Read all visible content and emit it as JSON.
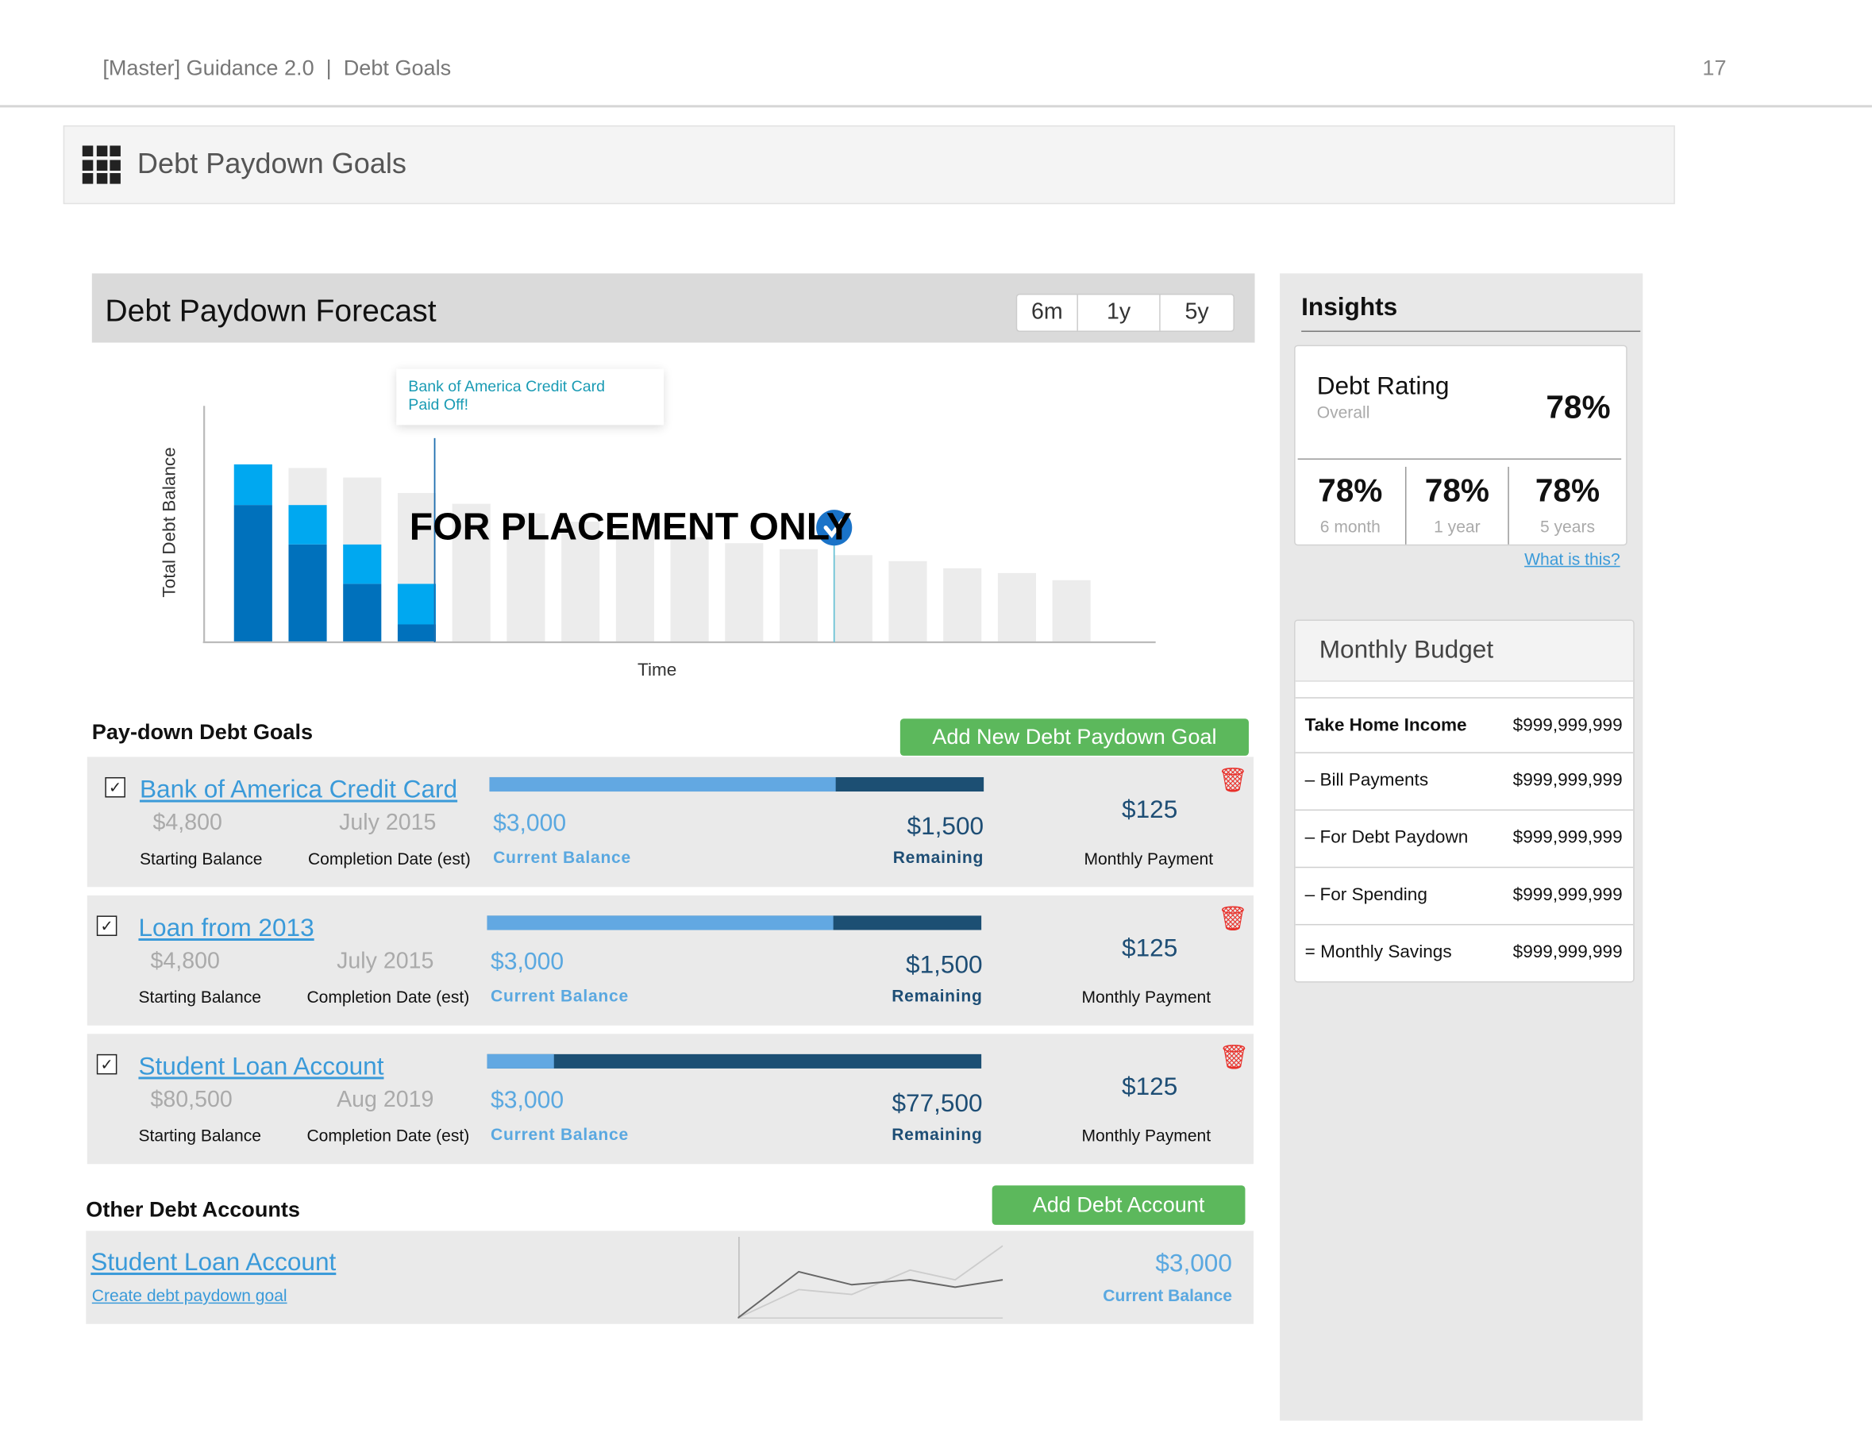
{
  "header": {
    "breadcrumb": "[Master] Guidance 2.0  |  Debt Goals",
    "page_number": "17"
  },
  "page_title": "Debt Paydown Goals",
  "forecast": {
    "title": "Debt Paydown Forecast",
    "ranges": [
      "6m",
      "1y",
      "5y"
    ],
    "tooltip_line1": "Bank of America Credit Card",
    "tooltip_line2": "Paid Off!",
    "placeholder_text": "FOR PLACEMENT ONLY",
    "colors": {
      "dark": "#0071bc",
      "light": "#00a8f0",
      "projected": "#ececec"
    }
  },
  "chart_data": {
    "type": "bar",
    "stacked": true,
    "xlabel": "Time",
    "ylabel": "Total Debt Balance",
    "grid": false,
    "categories": [
      1,
      2,
      3,
      4,
      5,
      6,
      7,
      8,
      9,
      10,
      11,
      12,
      13,
      14,
      15,
      16
    ],
    "series": [
      {
        "values": [
          115,
          82,
          49,
          15,
          0,
          0,
          0,
          0,
          0,
          0,
          0,
          0,
          0,
          0,
          0,
          0
        ]
      },
      {
        "values": [
          34,
          33,
          33,
          34,
          0,
          0,
          0,
          0,
          0,
          0,
          0,
          0,
          0,
          0,
          0,
          0
        ]
      },
      {
        "values": [
          0,
          31,
          56,
          76,
          116,
          108,
          101,
          94,
          88,
          83,
          78,
          73,
          68,
          62,
          58,
          52
        ]
      }
    ],
    "markers": [
      {
        "category": 4,
        "label": "Bank of America Credit Card Paid Off!"
      },
      {
        "category": 12,
        "icon": "check-circle-icon"
      }
    ]
  },
  "goals": {
    "title": "Pay-down Debt Goals",
    "add_button": "Add New Debt Paydown Goal",
    "labels": {
      "starting": "Starting Balance",
      "completion": "Completion Date (est)",
      "current": "Current Balance",
      "remaining": "Remaining",
      "monthly": "Monthly Payment"
    },
    "items": [
      {
        "name": "Bank of America Credit Card",
        "checked": true,
        "starting": "$4,800",
        "completion": "July 2015",
        "current": "$3,000",
        "remaining": "$1,500",
        "monthly": "$125",
        "progress": 0.7
      },
      {
        "name": "Loan from 2013",
        "checked": true,
        "starting": "$4,800",
        "completion": "July 2015",
        "current": "$3,000",
        "remaining": "$1,500",
        "monthly": "$125",
        "progress": 0.7
      },
      {
        "name": "Student Loan Account",
        "checked": true,
        "starting": "$80,500",
        "completion": "Aug 2019",
        "current": "$3,000",
        "remaining": "$77,500",
        "monthly": "$125",
        "progress": 0.135
      }
    ]
  },
  "other": {
    "title": "Other Debt Accounts",
    "add_button": "Add Debt Account",
    "account": {
      "name": "Student Loan Account",
      "link": "Create debt paydown goal",
      "current": "$3,000",
      "current_label": "Current Balance",
      "sparkline": {
        "x": [
          0,
          0.23,
          0.43,
          0.65,
          0.82,
          1
        ],
        "dark": [
          0,
          0.57,
          0.41,
          0.47,
          0.38,
          0.47
        ],
        "light": [
          0,
          0.35,
          0.29,
          0.59,
          0.47,
          0.89
        ]
      }
    }
  },
  "insights": {
    "title": "Insights",
    "rating": {
      "title": "Debt Rating",
      "sub": "Overall",
      "value": "78%",
      "periods": [
        {
          "value": "78%",
          "label": "6 month"
        },
        {
          "value": "78%",
          "label": "1 year"
        },
        {
          "value": "78%",
          "label": "5 years"
        }
      ],
      "help_link": "What is this?"
    },
    "budget": {
      "title": "Monthly Budget",
      "rows": [
        {
          "label": "Take Home Income",
          "value": "$999,999,999",
          "bold": true
        },
        {
          "label": "– Bill Payments",
          "value": "$999,999,999"
        },
        {
          "label": "– For Debt Paydown",
          "value": "$999,999,999"
        },
        {
          "label": "– For Spending",
          "value": "$999,999,999"
        },
        {
          "label": "= Monthly Savings",
          "value": "$999,999,999"
        }
      ]
    }
  }
}
